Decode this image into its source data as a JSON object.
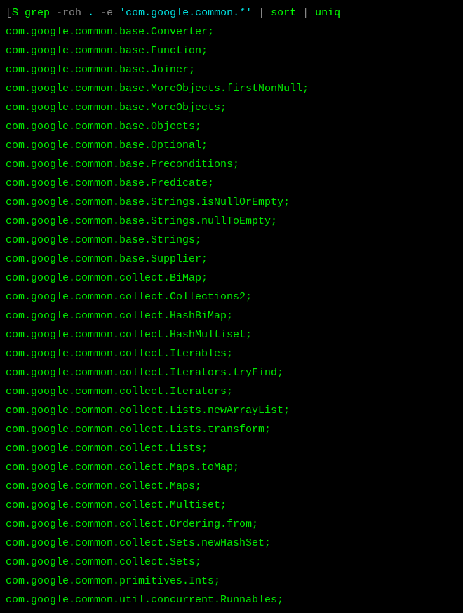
{
  "prompt": {
    "bracket": "[",
    "dollar": "$ ",
    "command": "grep",
    "flags": " -roh ",
    "path": ".",
    "dash_e": " -e ",
    "pattern": "'com.google.common.*'",
    "pipe1": " | ",
    "sort": "sort",
    "pipe2": " | ",
    "uniq": "uniq"
  },
  "output_lines": [
    "com.google.common.base.Converter;",
    "com.google.common.base.Function;",
    "com.google.common.base.Joiner;",
    "com.google.common.base.MoreObjects.firstNonNull;",
    "com.google.common.base.MoreObjects;",
    "com.google.common.base.Objects;",
    "com.google.common.base.Optional;",
    "com.google.common.base.Preconditions;",
    "com.google.common.base.Predicate;",
    "com.google.common.base.Strings.isNullOrEmpty;",
    "com.google.common.base.Strings.nullToEmpty;",
    "com.google.common.base.Strings;",
    "com.google.common.base.Supplier;",
    "com.google.common.collect.BiMap;",
    "com.google.common.collect.Collections2;",
    "com.google.common.collect.HashBiMap;",
    "com.google.common.collect.HashMultiset;",
    "com.google.common.collect.Iterables;",
    "com.google.common.collect.Iterators.tryFind;",
    "com.google.common.collect.Iterators;",
    "com.google.common.collect.Lists.newArrayList;",
    "com.google.common.collect.Lists.transform;",
    "com.google.common.collect.Lists;",
    "com.google.common.collect.Maps.toMap;",
    "com.google.common.collect.Maps;",
    "com.google.common.collect.Multiset;",
    "com.google.common.collect.Ordering.from;",
    "com.google.common.collect.Sets.newHashSet;",
    "com.google.common.collect.Sets;",
    "com.google.common.primitives.Ints;",
    "com.google.common.util.concurrent.Runnables;"
  ]
}
